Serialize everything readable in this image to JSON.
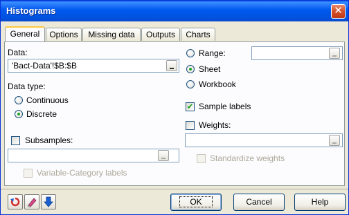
{
  "window": {
    "title": "Histograms",
    "close_label": "✕"
  },
  "tabs": [
    {
      "label": "General",
      "active": true
    },
    {
      "label": "Options",
      "active": false
    },
    {
      "label": "Missing data",
      "active": false
    },
    {
      "label": "Outputs",
      "active": false
    },
    {
      "label": "Charts",
      "active": false
    }
  ],
  "general": {
    "data_label": "Data:",
    "data_value": "'Bact-Data'!$B:$B",
    "data_type_label": "Data type:",
    "continuous_label": "Continuous",
    "continuous_selected": false,
    "discrete_label": "Discrete",
    "discrete_selected": true,
    "subsamples_label": "Subsamples:",
    "subsamples_checked": false,
    "subsamples_value": "",
    "variable_category_label": "Variable-Category labels",
    "variable_category_checked": false,
    "range_label": "Range:",
    "range_selected": false,
    "range_value": "",
    "sheet_label": "Sheet",
    "sheet_selected": true,
    "workbook_label": "Workbook",
    "workbook_selected": false,
    "sample_labels_label": "Sample labels",
    "sample_labels_checked": true,
    "weights_label": "Weights:",
    "weights_checked": false,
    "weights_value": "",
    "standardize_label": "Standardize weights",
    "standardize_checked": false
  },
  "buttons": {
    "ok": "OK",
    "cancel": "Cancel",
    "help": "Help"
  },
  "toolbar_icons": [
    "reset-icon",
    "eraser-icon",
    "arrow-down-icon"
  ],
  "colors": {
    "titlebar": "#0058ee",
    "accent_green": "#21a121",
    "reset_red": "#d42a2a",
    "arrow_blue": "#1a5fd0"
  }
}
